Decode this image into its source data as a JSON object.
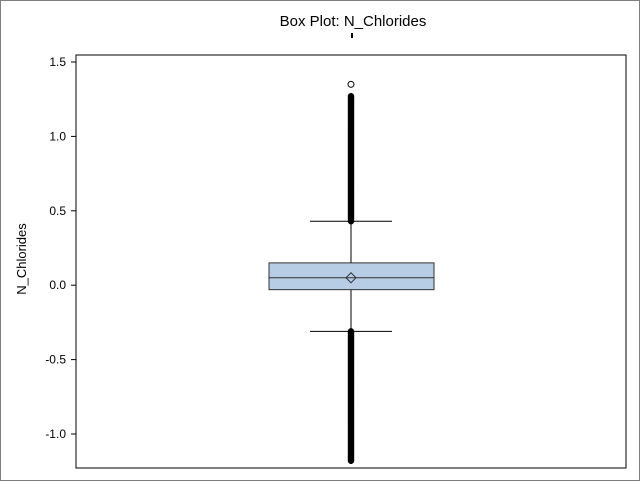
{
  "chart_data": {
    "type": "box",
    "title": "Box Plot: N_Chlorides",
    "xlabel": "",
    "ylabel": "N_Chlorides",
    "ylim": [
      -1.2,
      1.55
    ],
    "yticks": [
      1.5,
      1.0,
      0.5,
      0.0,
      -0.5,
      -1.0
    ],
    "ytick_labels": [
      "1.5",
      "1.0",
      "0.5",
      "0.0",
      "-0.5",
      "-1.0"
    ],
    "grid": false,
    "box": {
      "q1": -0.03,
      "median": 0.05,
      "mean": 0.05,
      "q3": 0.15,
      "whisker_low": -0.31,
      "whisker_high": 0.43
    },
    "outliers": {
      "upper_dense_range": [
        0.43,
        1.27
      ],
      "upper_isolated": [
        1.35
      ],
      "lower_dense_range": [
        -1.18,
        -0.31
      ]
    },
    "colors": {
      "box_fill": "#b7cde6",
      "box_stroke": "#333333",
      "outlier": "#000000",
      "frame": "#7f7f7f"
    }
  }
}
